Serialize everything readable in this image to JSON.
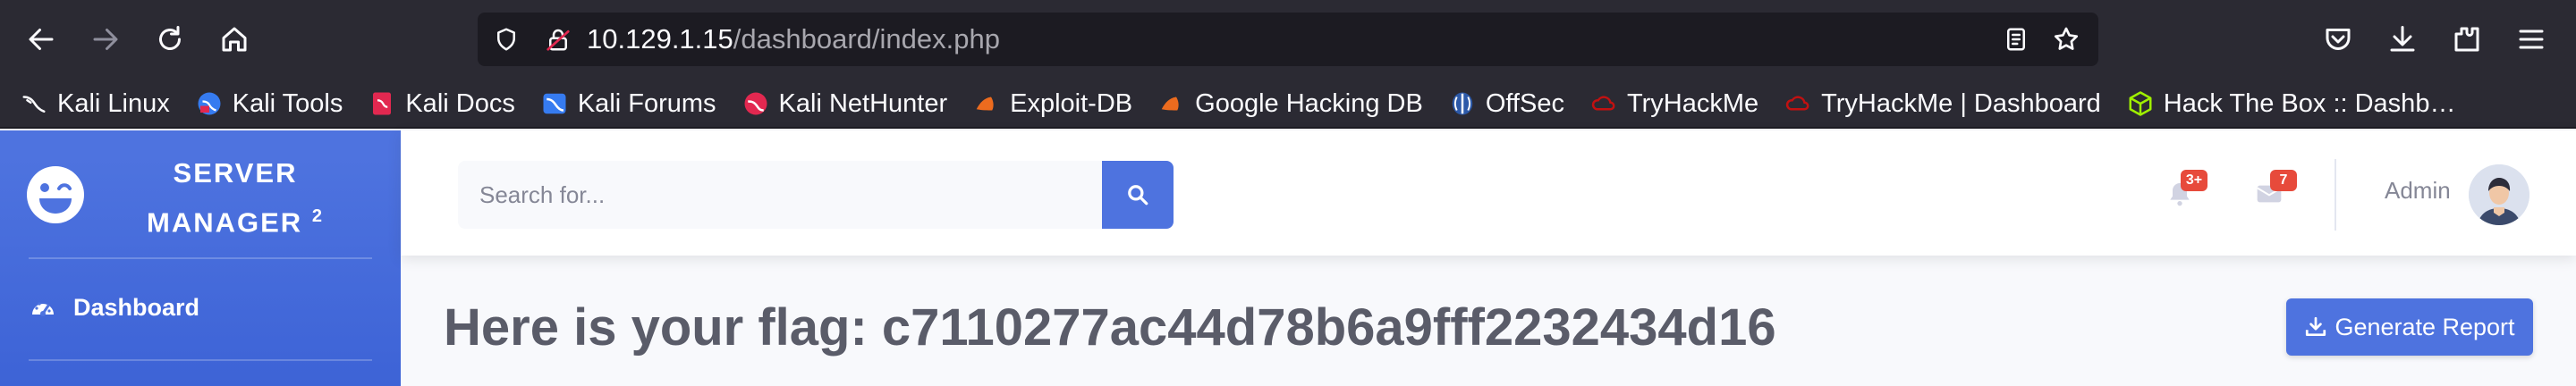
{
  "browser": {
    "url_host": "10.129.1.15",
    "url_path": "/dashboard/index.php",
    "icons": [
      "back-icon",
      "forward-icon",
      "reload-icon",
      "home-icon",
      "shield-icon",
      "lock-icon",
      "reader-icon",
      "star-icon",
      "pocket-icon",
      "download-icon",
      "extensions-icon",
      "menu-icon"
    ]
  },
  "bookmarks": [
    {
      "label": "Kali Linux",
      "icon": "kali-icon"
    },
    {
      "label": "Kali Tools",
      "icon": "kali-tools-icon"
    },
    {
      "label": "Kali Docs",
      "icon": "kali-docs-icon"
    },
    {
      "label": "Kali Forums",
      "icon": "kali-forums-icon"
    },
    {
      "label": "Kali NetHunter",
      "icon": "nethunter-icon"
    },
    {
      "label": "Exploit-DB",
      "icon": "exploit-db-icon"
    },
    {
      "label": "Google Hacking DB",
      "icon": "ghdb-icon"
    },
    {
      "label": "OffSec",
      "icon": "offsec-icon"
    },
    {
      "label": "TryHackMe",
      "icon": "tryhackme-icon"
    },
    {
      "label": "TryHackMe | Dashboard",
      "icon": "tryhackme-icon"
    },
    {
      "label": "Hack The Box :: Dashb…",
      "icon": "hackthebox-icon"
    }
  ],
  "sidebar": {
    "brand_line1": "SERVER",
    "brand_line2": "MANAGER",
    "brand_sup": "2",
    "items": [
      {
        "label": "Dashboard",
        "icon": "tachometer-icon"
      }
    ]
  },
  "topbar": {
    "search_placeholder": "Search for...",
    "alerts_count": "3+",
    "messages_count": "7",
    "user_name": "Admin"
  },
  "content": {
    "heading": "Here is your flag: c7110277ac44d78b6a9fff2232434d16",
    "report_button": "Generate Report"
  },
  "colors": {
    "primary": "#4e73df",
    "danger": "#e74a3b",
    "browser_chrome": "#2b2a33",
    "urlbar": "#1c1b22"
  }
}
